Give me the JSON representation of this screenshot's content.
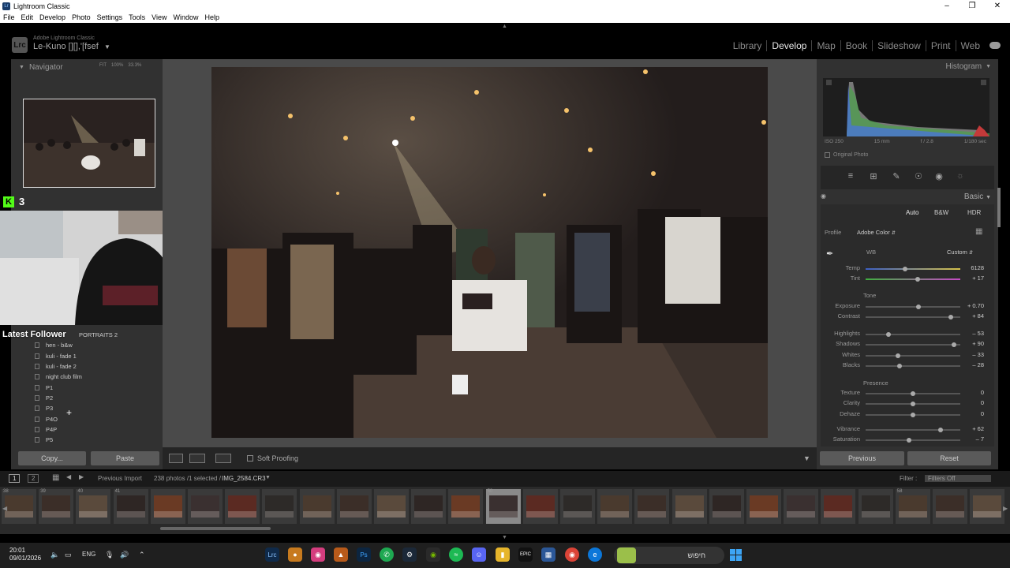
{
  "window": {
    "title": "Lightroom Classic"
  },
  "menu": [
    "File",
    "Edit",
    "Develop",
    "Photo",
    "Settings",
    "Tools",
    "View",
    "Window",
    "Help"
  ],
  "identity": {
    "badge": "Lrc",
    "subtitle": "Adobe Lightroom Classic",
    "name": "Le-Kuno [][],'[fsef"
  },
  "modules": [
    {
      "label": "Library",
      "active": false
    },
    {
      "label": "Develop",
      "active": true
    },
    {
      "label": "Map",
      "active": false
    },
    {
      "label": "Book",
      "active": false
    },
    {
      "label": "Slideshow",
      "active": false
    },
    {
      "label": "Print",
      "active": false
    },
    {
      "label": "Web",
      "active": false
    }
  ],
  "navigator": {
    "title": "Navigator",
    "fit": "FIT",
    "zoom1": "100%",
    "zoom2": "33.3%"
  },
  "overlay": {
    "kick_count": "3",
    "kick_logo": "K",
    "latest_follower": "Latest Follower"
  },
  "presets": {
    "partial_header": "PORTRAITS 2",
    "items": [
      "hen - b&w",
      "kuli - fade 1",
      "kuli - fade 2",
      "night club film",
      "P1",
      "P2",
      "P3",
      "P4O",
      "P4P",
      "P5"
    ]
  },
  "left_buttons": {
    "copy": "Copy...",
    "paste": "Paste"
  },
  "toolbar": {
    "soft_proofing": "Soft Proofing"
  },
  "histogram": {
    "title": "Histogram",
    "iso": "ISO 250",
    "focal": "15 mm",
    "aperture": "f / 2.8",
    "shutter": "1/180 sec",
    "original_photo": "Original Photo"
  },
  "basic": {
    "title": "Basic",
    "treatments": [
      "Auto",
      "B&W",
      "HDR"
    ],
    "profile_label": "Profile",
    "profile_value": "Adobe Color",
    "wb_label": "WB",
    "wb_value": "Custom",
    "tone_label": "Tone",
    "presence_label": "Presence",
    "sliders": [
      {
        "label": "Temp",
        "value": "6128",
        "pos": 0.42
      },
      {
        "label": "Tint",
        "value": "+ 17",
        "pos": 0.55
      },
      {
        "label": "Exposure",
        "value": "+ 0.70",
        "pos": 0.56
      },
      {
        "label": "Contrast",
        "value": "+ 84",
        "pos": 0.9
      },
      {
        "label": "Highlights",
        "value": "– 53",
        "pos": 0.24
      },
      {
        "label": "Shadows",
        "value": "+ 90",
        "pos": 0.93
      },
      {
        "label": "Whites",
        "value": "– 33",
        "pos": 0.34
      },
      {
        "label": "Blacks",
        "value": "– 28",
        "pos": 0.36
      },
      {
        "label": "Texture",
        "value": "0",
        "pos": 0.5
      },
      {
        "label": "Clarity",
        "value": "0",
        "pos": 0.5
      },
      {
        "label": "Dehaze",
        "value": "0",
        "pos": 0.5
      },
      {
        "label": "Vibrance",
        "value": "+ 62",
        "pos": 0.79
      },
      {
        "label": "Saturation",
        "value": "– 7",
        "pos": 0.46
      }
    ]
  },
  "right_buttons": {
    "previous": "Previous",
    "reset": "Reset"
  },
  "filmbar": {
    "page1": "1",
    "page2": "2",
    "source": "Previous Import",
    "count": "238 photos /1 selected /",
    "filename": "IMG_2584.CR3",
    "filter_label": "Filter :",
    "filter_value": "Filters Off"
  },
  "film_numbers": [
    "38",
    "39",
    "40",
    "41",
    "",
    "",
    "",
    "",
    "",
    "",
    "",
    "",
    "",
    "50",
    "",
    "",
    "",
    "",
    "",
    "",
    "",
    "",
    "",
    "",
    "58",
    "",
    "",
    "",
    "",
    "",
    "",
    "63"
  ],
  "taskbar": {
    "time": "20:01",
    "date": "09/01/2026",
    "lang": "ENG",
    "search_text": "חיפוש"
  },
  "colors": {
    "accent": "#53fc18",
    "panel": "#313131",
    "active_module": "#e8e8e8"
  }
}
